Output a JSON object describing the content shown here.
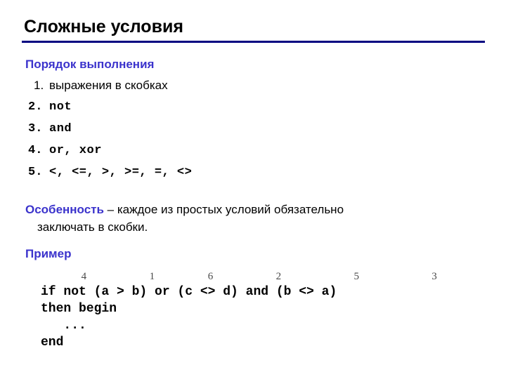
{
  "slide": {
    "title": "Сложные условия",
    "rule_color": "#000080",
    "accent_color": "#3B33CC",
    "text_color": "#000000",
    "background_color": "#FFFFFF"
  },
  "order_section": {
    "heading": "Порядок выполнения",
    "items": [
      {
        "num": "1.",
        "text": "выражения в скобках",
        "style": "sans"
      },
      {
        "num": "2.",
        "text": "not",
        "style": "mono"
      },
      {
        "num": "3.",
        "text": "and",
        "style": "mono"
      },
      {
        "num": "4.",
        "text": "or, xor",
        "style": "mono"
      },
      {
        "num": "5.",
        "text": "<, <=, >, >=, =, <>",
        "style": "mono"
      }
    ]
  },
  "note": {
    "lead": "Особенность",
    "rest": " – каждое из простых условий обязательно",
    "continuation": "заключать в скобки."
  },
  "example_section": {
    "heading": "Пример",
    "precedence_numbers": [
      {
        "value": "4",
        "col": 4
      },
      {
        "value": "1",
        "col": 11
      },
      {
        "value": "6",
        "col": 17
      },
      {
        "value": "2",
        "col": 24
      },
      {
        "value": "5",
        "col": 32
      },
      {
        "value": "3",
        "col": 40
      }
    ],
    "code_lines": [
      "if not (a > b) or (c <> d) and (b <> a)",
      "then begin",
      "   ...",
      "end"
    ]
  }
}
